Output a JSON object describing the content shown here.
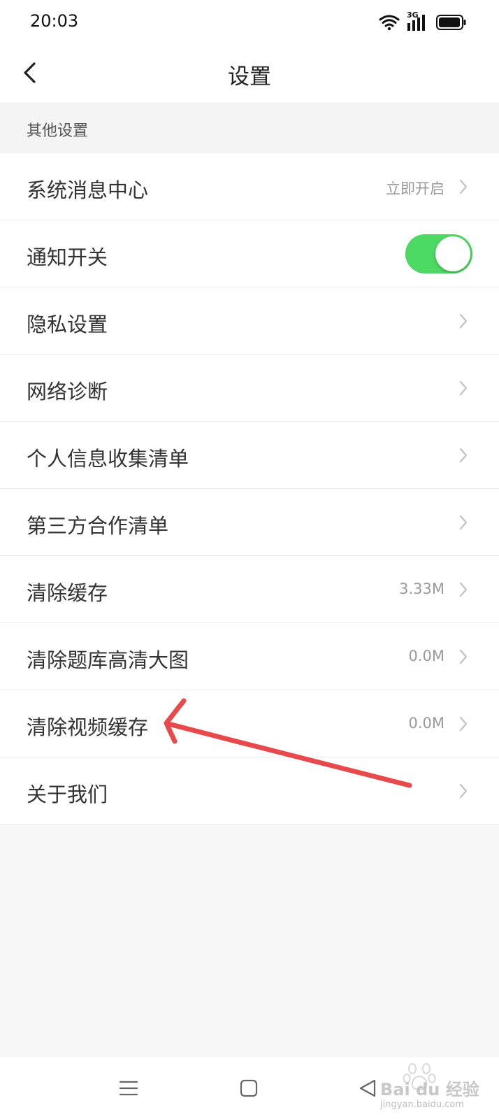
{
  "status_bar": {
    "time": "20:03",
    "network": "3G",
    "icons": [
      "wifi-icon",
      "signal-icon",
      "battery-icon"
    ]
  },
  "header": {
    "title": "设置",
    "back_icon": "back-chevron-icon"
  },
  "section": {
    "title": "其他设置"
  },
  "settings": [
    {
      "label": "系统消息中心",
      "value": "立即开启",
      "control": "chevron"
    },
    {
      "label": "通知开关",
      "value": "",
      "control": "toggle",
      "toggle_on": true
    },
    {
      "label": "隐私设置",
      "value": "",
      "control": "chevron"
    },
    {
      "label": "网络诊断",
      "value": "",
      "control": "chevron"
    },
    {
      "label": "个人信息收集清单",
      "value": "",
      "control": "chevron"
    },
    {
      "label": "第三方合作清单",
      "value": "",
      "control": "chevron"
    },
    {
      "label": "清除缓存",
      "value": "3.33M",
      "control": "chevron"
    },
    {
      "label": "清除题库高清大图",
      "value": "0.0M",
      "control": "chevron"
    },
    {
      "label": "清除视频缓存",
      "value": "0.0M",
      "control": "chevron"
    },
    {
      "label": "关于我们",
      "value": "",
      "control": "chevron"
    }
  ],
  "nav_bar": {
    "icons": [
      "menu-icon",
      "home-icon",
      "back-triangle-icon"
    ]
  },
  "watermark": {
    "text": "Bai du 经验",
    "subtext": "jingyan.baidu.com"
  },
  "colors": {
    "toggle_on": "#4cd964",
    "annotation_arrow": "#e8494a",
    "background": "#f7f7f7"
  }
}
